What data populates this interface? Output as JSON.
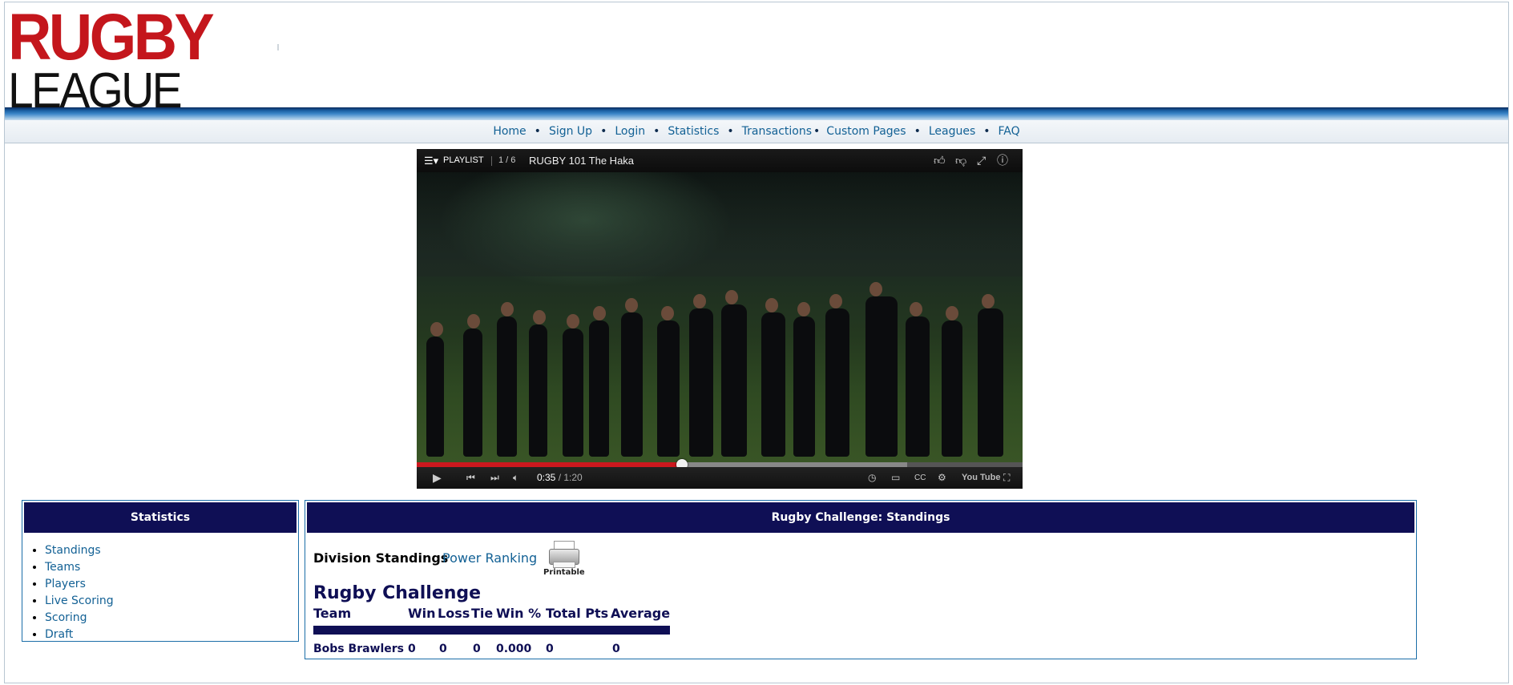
{
  "logo": {
    "line1": "RUGBY",
    "line2": "LEAGUE"
  },
  "nav": {
    "items": [
      "Home",
      "Sign Up",
      "Login",
      "Statistics",
      "Transactions",
      "Custom Pages",
      "Leagues",
      "FAQ"
    ],
    "separator": "•"
  },
  "video": {
    "playlist_label": "PLAYLIST",
    "playlist_position": "1 / 6",
    "title": "RUGBY 101 The Haka",
    "current_time": "0:35",
    "duration": " / 1:20",
    "played_fraction": 0.4375,
    "loaded_fraction": 0.81,
    "brand": "You Tube",
    "icons": [
      "playlist-icon",
      "like-icon",
      "dislike-icon",
      "share-icon",
      "info-icon",
      "play-icon",
      "previous-icon",
      "next-icon",
      "volume-icon",
      "watch-later-icon",
      "miniplayer-icon",
      "captions-icon",
      "settings-icon",
      "fullscreen-icon"
    ]
  },
  "stats_panel": {
    "title": "Statistics",
    "links": [
      "Standings",
      "Teams",
      "Players",
      "Live Scoring",
      "Scoring",
      "Draft"
    ]
  },
  "standings_panel": {
    "title": "Rugby Challenge: Standings",
    "current_view": "Division Standings",
    "alt_view": "Power Ranking",
    "printable_label": "Printable",
    "division": "Rugby Challenge",
    "columns": [
      "Team",
      "Win",
      "Loss",
      "Tie",
      "Win %",
      "Total Pts",
      "Average"
    ],
    "rows": [
      {
        "team": "Bobs Brawlers",
        "win": "0",
        "loss": "0",
        "tie": "0",
        "win_pct": "0.000",
        "total_pts": "0",
        "average": "0"
      }
    ]
  },
  "colors": {
    "header_navy": "#0f0f55",
    "link_blue": "#136195",
    "logo_red": "#c4161c",
    "progress_red": "#cc181e"
  }
}
